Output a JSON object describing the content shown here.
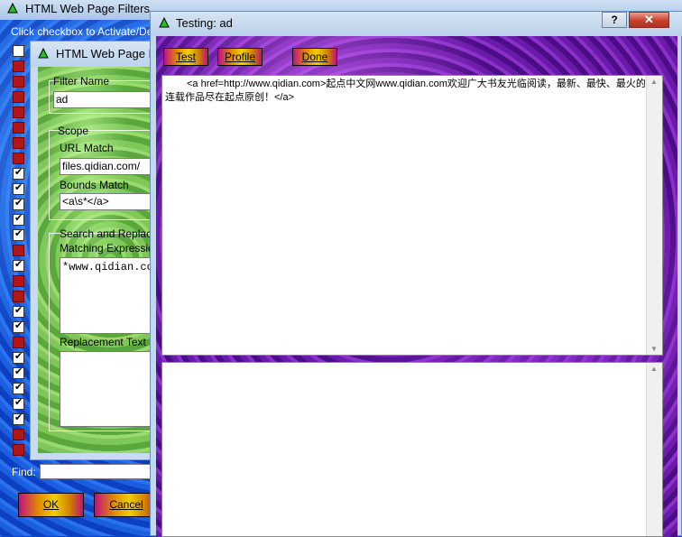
{
  "main_window": {
    "title": "HTML Web Page Filters",
    "hint": "Click checkbox to Activate/Deac",
    "find_label": "Find:",
    "find_value": "",
    "ok_label": "OK",
    "cancel_label": "Cancel"
  },
  "filter_window": {
    "title": "HTML Web Page F",
    "filter_name_label": "Filter Name",
    "filter_name_value": "ad",
    "scope_label": "Scope",
    "url_match_label": "URL Match",
    "url_match_value": "files.qidian.com/",
    "bounds_match_label": "Bounds Match",
    "bounds_match_value": "<a\\s*</a>",
    "search_replace_label": "Search and Replace",
    "matching_expression_label": "Matching Expression",
    "matching_expression_value": "*www.qidian.co",
    "replacement_text_label": "Replacement Text",
    "replacement_text_value": ""
  },
  "test_window": {
    "title": "Testing: ad",
    "help_label": "?",
    "close_label": "✕",
    "test_label": "Test",
    "profile_label": "Profile",
    "done_label": "Done",
    "source_text": "<a href=http://www.qidian.com>起点中文网www.qidian.com欢迎广大书友光临阅读，最新、最快、最火的连载作品尽在起点原创！</a>",
    "result_text": ""
  },
  "icons": {
    "app_icon": "green-triangle-icon",
    "scroll_up": "scroll-up-arrow-icon",
    "scroll_down": "scroll-down-arrow-icon"
  },
  "colors": {
    "button_gold": "#f0d000",
    "purple_bg": "#6a1aa8",
    "green_bg": "#7ec85a",
    "blue_bg": "#1a5fe0",
    "close_red": "#c8402c"
  }
}
